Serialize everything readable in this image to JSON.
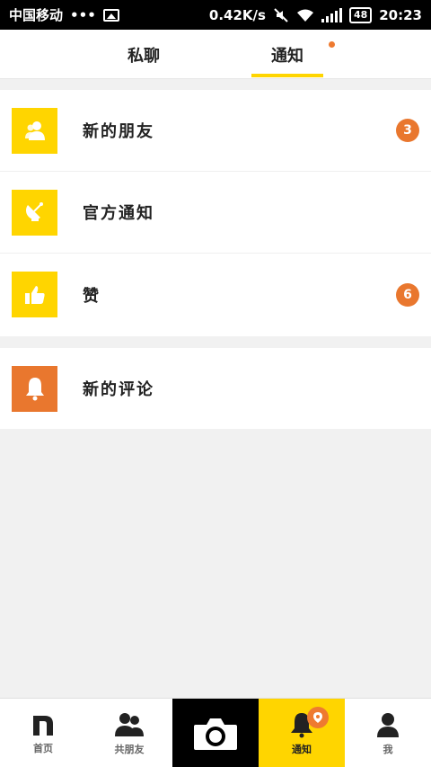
{
  "status_bar": {
    "carrier": "中国移动",
    "dots": "•••",
    "speed": "0.42K/s",
    "battery": "48",
    "time": "20:23"
  },
  "tabs": [
    {
      "label": "私聊",
      "active": false
    },
    {
      "label": "通知",
      "active": true,
      "has_dot": true
    }
  ],
  "list": [
    {
      "label": "新的朋友",
      "icon": "people-icon",
      "icon_color": "#ffd500",
      "badge": "3"
    },
    {
      "label": "官方通知",
      "icon": "satellite-dish-icon",
      "icon_color": "#ffd500",
      "badge": ""
    },
    {
      "label": "赞",
      "icon": "thumbs-up-icon",
      "icon_color": "#ffd500",
      "badge": "6"
    },
    {
      "label": "新的评论",
      "icon": "bell-icon",
      "icon_color": "#e9772e",
      "badge": ""
    }
  ],
  "bottom_nav": [
    {
      "label": "首页",
      "icon": "home-n-icon"
    },
    {
      "label": "共朋友",
      "icon": "friends-icon"
    },
    {
      "label": "",
      "icon": "camera-icon"
    },
    {
      "label": "通知",
      "icon": "bell-icon",
      "active": true
    },
    {
      "label": "我",
      "icon": "profile-icon"
    }
  ],
  "colors": {
    "accent_yellow": "#ffd500",
    "accent_orange": "#e9772e"
  }
}
